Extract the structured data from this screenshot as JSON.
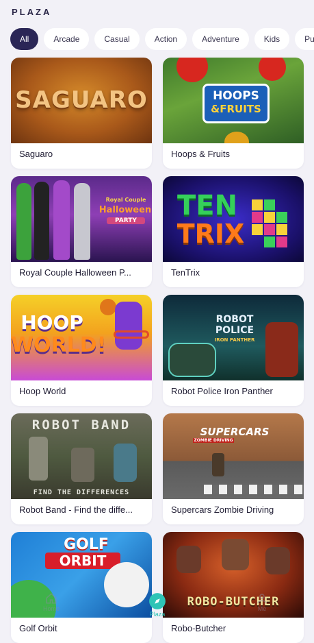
{
  "header": {
    "title": "PLAZA"
  },
  "categories": [
    {
      "label": "All",
      "active": true
    },
    {
      "label": "Arcade"
    },
    {
      "label": "Casual"
    },
    {
      "label": "Action"
    },
    {
      "label": "Adventure"
    },
    {
      "label": "Kids"
    },
    {
      "label": "Pu"
    }
  ],
  "games": [
    {
      "title": "Saguaro",
      "logo": "SAGUARO"
    },
    {
      "title": "Hoops & Fruits",
      "logo_top": "HOOPS",
      "logo_bottom": "&FRUITS"
    },
    {
      "title": "Royal Couple Halloween P...",
      "logo_small": "Royal Couple",
      "logo_main": "Halloween",
      "logo_tag": "PARTY"
    },
    {
      "title": "TenTrix",
      "logo_top": "TEN",
      "logo_bottom": "TRIX"
    },
    {
      "title": "Hoop World",
      "logo_top": "HOOP",
      "logo_bottom": "WORLD!"
    },
    {
      "title": "Robot Police Iron Panther",
      "logo_top": "ROBOT",
      "logo_bottom": "POLICE",
      "logo_tag": "IRON PANTHER"
    },
    {
      "title": "Robot Band - Find the diffe...",
      "logo_top": "ROBOT BAND",
      "logo_bottom": "FIND THE DIFFERENCES"
    },
    {
      "title": "Supercars Zombie Driving",
      "logo_top": "SUPERCARS",
      "logo_bottom": "ZOMBIE DRIVING"
    },
    {
      "title": "Golf Orbit",
      "logo_top": "GOLF",
      "logo_bottom": "ORBIT"
    },
    {
      "title": "Robo-Butcher",
      "logo": "ROBO-BUTCHER"
    }
  ],
  "nav": {
    "items": [
      {
        "label": "Home",
        "icon": "home-icon"
      },
      {
        "label": "Plaza",
        "icon": "compass-icon",
        "active": true
      },
      {
        "label": "Me",
        "icon": "user-icon"
      }
    ],
    "active_color": "#2ec4b6"
  }
}
